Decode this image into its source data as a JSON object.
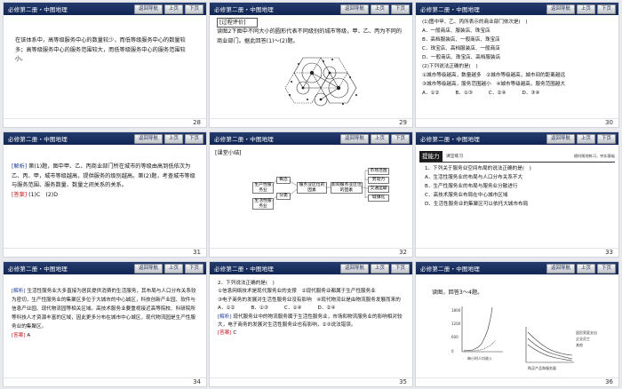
{
  "header": {
    "title": "必修第二册・中图地理",
    "nav": "返回导航",
    "prev": "上页",
    "next": "下页"
  },
  "slides": [
    {
      "page": "28",
      "text": "在该体系中，高等级服务中心的数量较少，而低等级服务中心的数量较多；高等级服务中心的服务范围较大，而低等级服务中心的服务范围较小。"
    },
    {
      "page": "29",
      "tag": "[过程评价]",
      "text": "读图2下图中不同大小的圆形代表不同级别的城市等级，甲、乙、丙为不同的商业部门。据此回答(1)～(2)题。"
    },
    {
      "page": "30",
      "q1": "(1)图中甲、乙、丙所表示的商业部门依次是(　)",
      "q1_opts": [
        "A．一般商店、服装店、珠宝店",
        "B．高档服装店、一般商店、珠宝店",
        "C．珠宝店、高档服装店、一般商店",
        "D．一般商店、珠宝店、高档服装店"
      ],
      "q2": "(2)下列说法正确的是(　)",
      "q2_items": [
        "①城市等级越高，数量越多　②城市等级越高，城市间的距离越远",
        "③城市等级越高，服务范围越小　④城市等级越高，服务范围越大"
      ],
      "q2_opts": [
        "A．①②",
        "B．①③",
        "C．②④",
        "D．③④"
      ]
    },
    {
      "page": "31",
      "label": "[解析]",
      "text": "第(1)题，图中甲、乙、丙商业部门所在城市的等级由高到低依次为乙、丙、甲，城市等级越高，提供服务的级别越高。第(2)题，考查城市等级与服务范围、服务数量、数量之间关系的关系。",
      "ans_label": "[答案]",
      "ans": "(1)C　(2)D"
    },
    {
      "page": "32",
      "label": "[课堂小结]",
      "boxes": [
        "生产性服务业",
        "生活性服务业",
        "概念",
        "分类",
        "服务业区位的因素",
        "影响服务业区位的因素",
        "市场范围",
        "劳动力",
        "交通运输",
        "城镇化"
      ]
    },
    {
      "page": "33",
      "banner": "提能力",
      "banner_sub": "课堂练习",
      "banner_right": "随时随地练习，夯实基础",
      "q": "1．下列关于服务业空间布局的说法正确的是(　)",
      "opts": [
        "A．生活性服务业的布局与人口分布关系不大",
        "B．生产性服务业的布局与服务业分散进行",
        "C．高技术服务业布局在中心城市区域",
        "D．生活性服务业的集聚区可以依托大城市布局"
      ]
    },
    {
      "page": "34",
      "label": "[解析]",
      "text": "生活性服务业大多直接为居民提供消费的生活服务，其布局与人口分布关系较为密切，生产性服务业的集聚区多位于大城市的中心城区，科技创新产业园、软件与信息产业园、现代物流园等相关区域。高技术服务业要重视接近高等院校、科研院所等科技人才资源丰富的区域，因此更多分布在城市中心城区，现代物流园是生产性服务业的集聚区。",
      "ans_label": "[答案]",
      "ans": "A"
    },
    {
      "page": "35",
      "q": "2．下列说法正确的是(　)",
      "items": [
        "①信息网络技术是现代服务业的支撑　②现代服务业都属于生产性服务业",
        "③电子商务的发展对生活性服务业没有影响　④现代物流业是由物流服务发展而来的"
      ],
      "opts": [
        "A．①②",
        "B．①③",
        "C．①④",
        "D．②④"
      ],
      "label": "[解析]",
      "text": "现代服务业中的物流服务属于生活性服务业，市场和物流服务业的影响相对较大，电子商务的发展对生活性服务业也有影响，②③说法错误。",
      "ans_label": "[答案]",
      "ans": "C"
    },
    {
      "page": "36",
      "intro": "读图，回答3～4题。",
      "chart_left": {
        "ylabel": "年人均服务费用",
        "xlabel": "每小时人均收入",
        "yticks": [
          "1800",
          "1200",
          "600",
          "0"
        ]
      },
      "chart_right": {
        "legend": [
          "居民家庭支出",
          "企业员工",
          "其他"
        ],
        "xlabel": "购买产品和服务量"
      }
    }
  ]
}
